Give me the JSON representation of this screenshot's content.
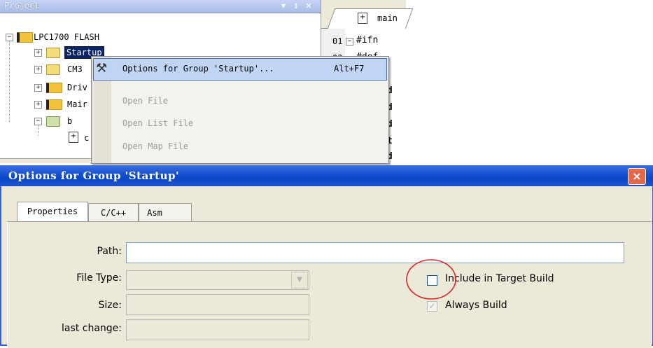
{
  "project_panel": {
    "title": "Project",
    "title_buttons": [
      "▾",
      "ᵻ",
      "×"
    ],
    "tree": [
      {
        "label": "LPC1700 FLASH",
        "toggle": "−"
      },
      {
        "label": "Startup",
        "toggle": "+"
      },
      {
        "label": "CM3",
        "toggle": "+"
      },
      {
        "label": "Driv",
        "toggle": "+"
      },
      {
        "label": "Mair",
        "toggle": "+"
      },
      {
        "label": "b",
        "toggle": "−"
      },
      {
        "label": "c",
        "toggle": ""
      }
    ]
  },
  "editor": {
    "tab_label": "main",
    "lines": [
      {
        "num": "01",
        "marker": "−",
        "text": "#ifn"
      },
      {
        "num": "02",
        "marker": "",
        "text": "#def"
      },
      {
        "num": "",
        "marker": "",
        "text": "id"
      },
      {
        "num": "",
        "marker": "",
        "text": "id"
      },
      {
        "num": "",
        "marker": "",
        "text": "id"
      },
      {
        "num": "",
        "marker": "",
        "text": "at"
      },
      {
        "num": "",
        "marker": "",
        "text": "id"
      }
    ]
  },
  "context_menu": {
    "items": [
      {
        "label": "Options for Group 'Startup'...",
        "shortcut": "Alt+F7",
        "enabled": true
      },
      {
        "label": "Open File",
        "shortcut": "",
        "enabled": false
      },
      {
        "label": "Open List File",
        "shortcut": "",
        "enabled": false
      },
      {
        "label": "Open Map File",
        "shortcut": "",
        "enabled": false
      }
    ]
  },
  "dialog": {
    "title": "Options for Group 'Startup'",
    "close_label": "×",
    "tabs": [
      "Properties",
      "C/C++",
      "Asm"
    ],
    "fields": {
      "path_label": "Path:",
      "path_value": "",
      "file_type_label": "File Type:",
      "file_type_value": "",
      "size_label": "Size:",
      "size_value": "",
      "last_change_label": "last change:",
      "last_change_value": ""
    },
    "include_in_target_build": {
      "label": "Include in Target Build",
      "checked": false
    },
    "always_build": {
      "label": "Always Build",
      "checked": true,
      "enabled": false
    }
  },
  "colors": {
    "dialog_title": "#0a46c8",
    "highlight_circle": "#d9262c",
    "menu_highlight": "#c0d4f4"
  }
}
